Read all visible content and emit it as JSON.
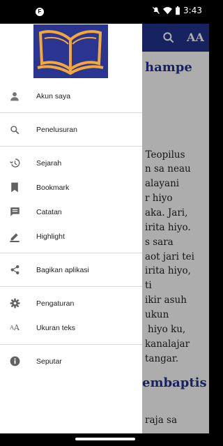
{
  "status_bar": {
    "time": "3:43",
    "icons": [
      "notification-icon",
      "mute-icon",
      "wifi-icon",
      "battery-icon"
    ]
  },
  "background": {
    "toolbar_icons": [
      "search-icon",
      "font-size-icon"
    ],
    "font_icon_text": "AA",
    "heading_1": "hampe",
    "heading_2": "embaptis",
    "lines": [
      ", Teopilus",
      "n sa neau",
      "alayani",
      "r hiyo",
      "aka. Jari,",
      "irita hiyo.",
      "s sara",
      "aot jari tei",
      "irita hiyo,",
      "ti",
      "ikir asuh",
      "ukun",
      "hiyo ku,",
      "kanalajar",
      "tangar.",
      "raja sa"
    ]
  },
  "drawer": {
    "logo": "book-logo",
    "groups": [
      [
        {
          "id": "account",
          "label": "Akun saya",
          "icon": "person-icon"
        }
      ],
      [
        {
          "id": "search",
          "label": "Penelusuran",
          "icon": "search-icon"
        }
      ],
      [
        {
          "id": "history",
          "label": "Sejarah",
          "icon": "history-icon"
        },
        {
          "id": "bookmark",
          "label": "Bookmark",
          "icon": "bookmark-icon"
        },
        {
          "id": "notes",
          "label": "Catatan",
          "icon": "notes-icon"
        },
        {
          "id": "highlight",
          "label": "Highlight",
          "icon": "highlight-icon"
        }
      ],
      [
        {
          "id": "share",
          "label": "Bagikan aplikasi",
          "icon": "share-icon"
        }
      ],
      [
        {
          "id": "settings",
          "label": "Pengaturan",
          "icon": "settings-icon"
        },
        {
          "id": "text-size",
          "label": "Ukuran teks",
          "icon": "text-size-icon"
        }
      ],
      [
        {
          "id": "about",
          "label": "Seputar",
          "icon": "info-icon"
        }
      ]
    ]
  },
  "colors": {
    "toolbar": "#22348e",
    "logo_bg": "#2a3491",
    "logo_book": "#f4a83a"
  }
}
